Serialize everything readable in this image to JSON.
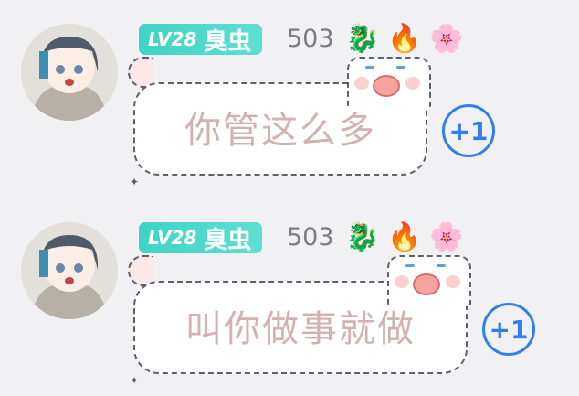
{
  "messages": [
    {
      "level": "LV28",
      "nickname": "臭虫",
      "score": "503",
      "emojis": [
        "dragon",
        "fire",
        "flower-laugh"
      ],
      "text": "你管这么多",
      "plus": "+1"
    },
    {
      "level": "LV28",
      "nickname": "臭虫",
      "score": "503",
      "emojis": [
        "dragon",
        "fire",
        "flower-laugh"
      ],
      "text": "叫你做事就做",
      "plus": "+1"
    }
  ],
  "colors": {
    "badge": "#45d6c8",
    "plus": "#2f7ff0",
    "bubble_text": "#d4b1b1",
    "background": "#f1f1f3"
  }
}
